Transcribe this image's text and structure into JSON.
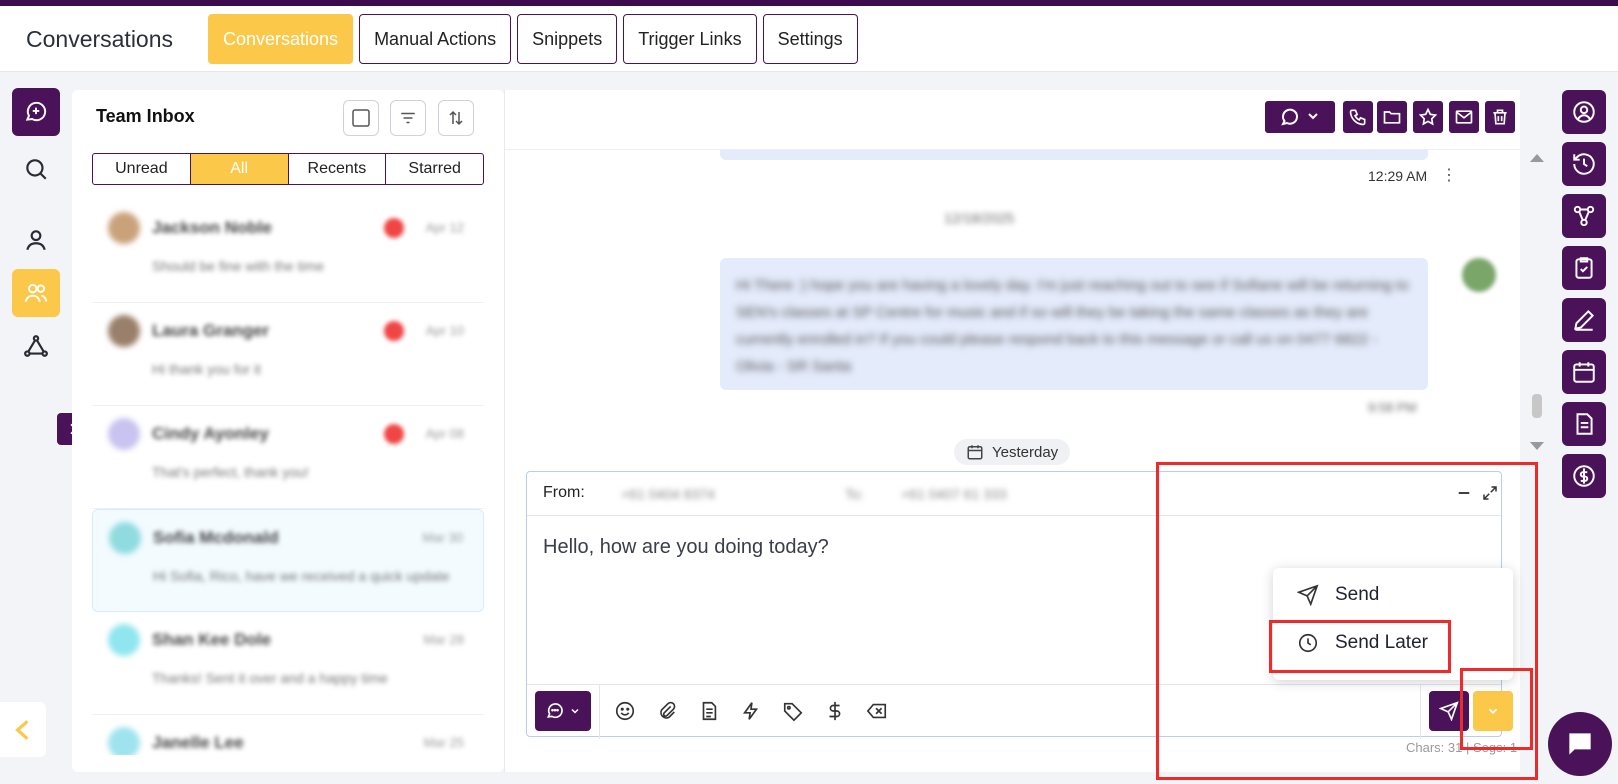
{
  "app": {
    "title": "Conversations"
  },
  "topnav": [
    {
      "label": "Conversations",
      "active": true
    },
    {
      "label": "Manual Actions",
      "active": false
    },
    {
      "label": "Snippets",
      "active": false
    },
    {
      "label": "Trigger Links",
      "active": false
    },
    {
      "label": "Settings",
      "active": false
    }
  ],
  "inbox": {
    "title": "Team Inbox",
    "filters": [
      "Unread",
      "All",
      "Recents",
      "Starred"
    ],
    "active_filter": "All",
    "conversations": [
      {
        "name": "Jackson Noble",
        "meta": "Apr 12",
        "preview": "Should be fine with the time",
        "avatar_color": "#c9a27a"
      },
      {
        "name": "Laura Granger",
        "meta": "Apr 10",
        "preview": "Hi thank you for it",
        "avatar_color": "#9a7f6a"
      },
      {
        "name": "Cindy Ayonley",
        "meta": "Apr 08",
        "preview": "That's perfect, thank you!",
        "avatar_color": "#c8c3f0"
      },
      {
        "name": "Sofia Mcdonald",
        "meta": "Mar 30",
        "preview": "Hi Sofia, Rico, have we received a quick update",
        "avatar_color": "#8fdbe0"
      },
      {
        "name": "Shan Kee Dole",
        "meta": "Mar 28",
        "preview": "Thanks! Sent it over and a happy time",
        "avatar_color": "#8fe6ee"
      },
      {
        "name": "Janelle Lee",
        "meta": "Mar 25",
        "preview": "",
        "avatar_color": "#9fe3ee"
      }
    ]
  },
  "thread": {
    "prev_time": "12:29 AM",
    "date_separator": "12/18/2025",
    "message": "Hi There :) hope you are having a lovely day. I'm just reaching out to see if Sofiane will be returning to SEN's classes at SP Centre for music and if so will they be taking the same classes as they are currently enrolled in? If you could please respond back to this message or call us on 0477 6822 - Olivia - SR Santa",
    "message_time": "9:58 PM",
    "day_chip": "Yesterday"
  },
  "composer": {
    "from_label": "From:",
    "from_value": "+61 0404 8374",
    "to_label": "To:",
    "to_value": "+61 0407 61 333",
    "text": "Hello, how are you doing today?",
    "chars_text": "Chars: 31 | Segs: 1"
  },
  "send_menu": {
    "send_label": "Send",
    "send_later_label": "Send Later"
  },
  "colors": {
    "brand": "#4a1359",
    "accent": "#fcc84a",
    "highlight": "#ee2b2b"
  }
}
